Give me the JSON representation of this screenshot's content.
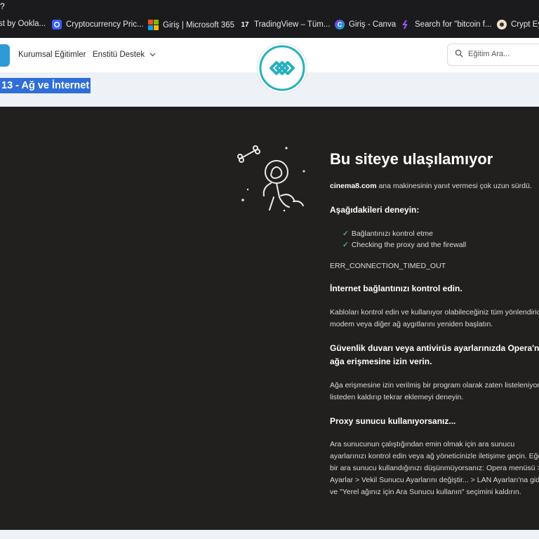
{
  "top_partial_text": "?",
  "bookmarks": [
    {
      "label": "st by Ookla...",
      "icon": "ookla-icon"
    },
    {
      "label": "Cryptocurrency Pric...",
      "icon": "coinmarketcap-icon"
    },
    {
      "label": "Giriş | Microsoft 365",
      "icon": "microsoft-icon"
    },
    {
      "label": "TradingView – Tüm...",
      "icon": "tradingview-icon"
    },
    {
      "label": "Giriş - Canva",
      "icon": "canva-icon"
    },
    {
      "label": "Search for \"bitcoin f...",
      "icon": "search-bookmark-icon"
    },
    {
      "label": "Crypt Ey",
      "icon": "cryptoeye-icon"
    }
  ],
  "site_nav": {
    "links": [
      "Kurumsal Eğitimler",
      "Enstitü Destek"
    ],
    "search_placeholder": "Eğitim Ara..."
  },
  "course_title": "13 - Ağ ve İnternet",
  "error": {
    "title": "Bu siteye ulaşılamıyor",
    "host": "cinema8.com",
    "host_suffix": " ana makinesinin yanıt vermesi çok uzun sürdü.",
    "try_heading": "Aşağıdakileri deneyin:",
    "suggestions": [
      "Bağlantınızı kontrol etme",
      "Checking the proxy and the firewall"
    ],
    "code": "ERR_CONNECTION_TIMED_OUT",
    "sections": [
      {
        "heading": [
          "İnternet bağlantınızı kontrol edin."
        ],
        "lines": [
          "Kabloları kontrol edin ve kullanıyor olabileceğiniz tüm yönlendiric",
          "modem veya diğer ağ aygıtlarını yeniden başlatın."
        ]
      },
      {
        "heading": [
          "Güvenlik duvarı veya antivirüs ayarlarınızda Opera'nın",
          "ağa erişmesine izin verin."
        ],
        "lines": [
          "Ağa erişmesine izin verilmiş bir program olarak zaten listeleniyors",
          "listeden kaldırıp tekrar eklemeyi deneyin."
        ]
      },
      {
        "heading": [
          "Proxy sunucu kullanıyorsanız..."
        ],
        "lines": [
          "Ara sunucunun çalıştığından emin olmak için ara sunucu",
          "ayarlarınızı kontrol edin veya ağ yöneticinizle iletişime geçin. Eğer",
          "bir ara sunucu kullandığınızı düşünmüyorsanız: Opera menüsü >",
          "Ayarlar > Vekil Sunucu Ayarlarını değiştir... > LAN Ayarları'na gidi",
          "ve \"Yerel ağınız için Ara Sunucu kullanın\" seçimini kaldırın."
        ]
      }
    ]
  }
}
